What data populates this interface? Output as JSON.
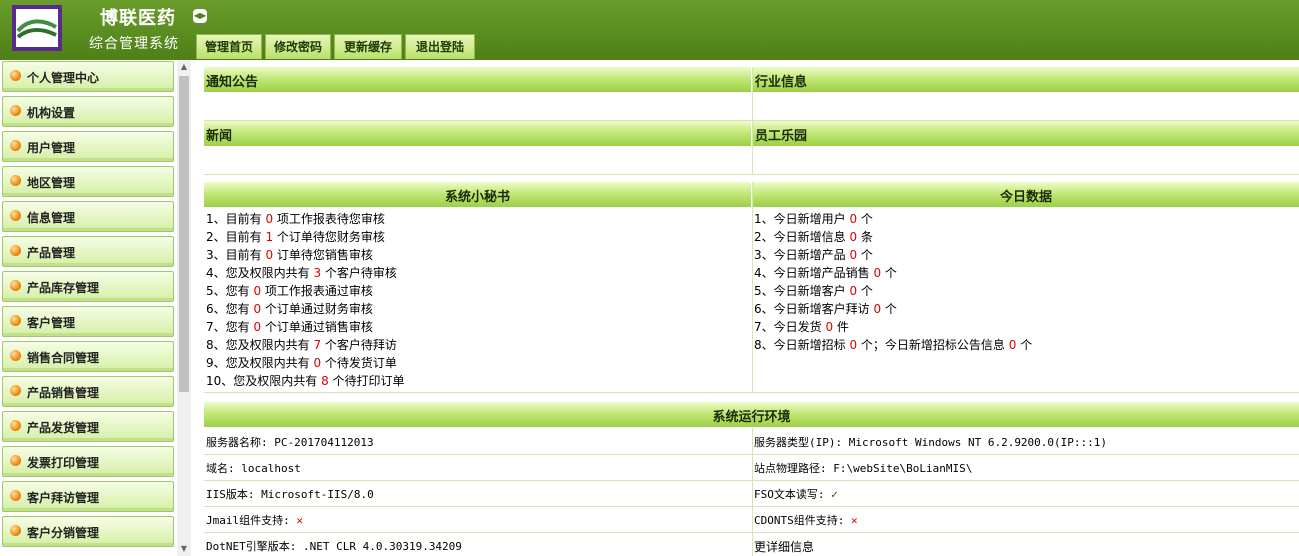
{
  "header": {
    "company": "博联医药",
    "system": "综合管理系统",
    "tabs": [
      "管理首页",
      "修改密码",
      "更新缓存",
      "退出登陆"
    ]
  },
  "sidebar": {
    "items": [
      "个人管理中心",
      "机构设置",
      "用户管理",
      "地区管理",
      "信息管理",
      "产品管理",
      "产品库存管理",
      "客户管理",
      "销售合同管理",
      "产品销售管理",
      "产品发货管理",
      "发票打印管理",
      "客户拜访管理",
      "客户分销管理"
    ]
  },
  "panels": {
    "notice": "通知公告",
    "industry": "行业信息",
    "news": "新闻",
    "staff": "员工乐园",
    "secretary": "系统小秘书",
    "today": "今日数据",
    "env": "系统运行环境"
  },
  "secretary": [
    {
      "pre": "1、目前有 ",
      "n": "0",
      "post": " 项工作报表待您审核"
    },
    {
      "pre": "2、目前有 ",
      "n": "1",
      "post": " 个订单待您财务审核"
    },
    {
      "pre": "3、目前有 ",
      "n": "0",
      "post": " 订单待您销售审核"
    },
    {
      "pre": "4、您及权限内共有 ",
      "n": "3",
      "post": " 个客户待审核"
    },
    {
      "pre": "5、您有 ",
      "n": "0",
      "post": " 项工作报表通过审核"
    },
    {
      "pre": "6、您有 ",
      "n": "0",
      "post": " 个订单通过财务审核"
    },
    {
      "pre": "7、您有 ",
      "n": "0",
      "post": " 个订单通过销售审核"
    },
    {
      "pre": "8、您及权限内共有 ",
      "n": "7",
      "post": " 个客户待拜访"
    },
    {
      "pre": "9、您及权限内共有 ",
      "n": "0",
      "post": " 个待发货订单"
    },
    {
      "pre": "10、您及权限内共有 ",
      "n": "8",
      "post": " 个待打印订单"
    }
  ],
  "today": [
    {
      "pre": "1、今日新增用户 ",
      "n": "0",
      "post": " 个",
      "n2": "",
      "post2": ""
    },
    {
      "pre": "2、今日新增信息 ",
      "n": "0",
      "post": " 条",
      "n2": "",
      "post2": ""
    },
    {
      "pre": "3、今日新增产品 ",
      "n": "0",
      "post": " 个",
      "n2": "",
      "post2": ""
    },
    {
      "pre": "4、今日新增产品销售 ",
      "n": "0",
      "post": " 个",
      "n2": "",
      "post2": ""
    },
    {
      "pre": "5、今日新增客户 ",
      "n": "0",
      "post": " 个",
      "n2": "",
      "post2": ""
    },
    {
      "pre": "6、今日新增客户拜访 ",
      "n": "0",
      "post": " 个",
      "n2": "",
      "post2": ""
    },
    {
      "pre": "7、今日发货 ",
      "n": "0",
      "post": " 件",
      "n2": "",
      "post2": ""
    },
    {
      "pre": "8、今日新增招标 ",
      "n": "0",
      "post": " 个；今日新增招标公告信息 ",
      "n2": "0",
      "post2": " 个"
    }
  ],
  "env": {
    "server_name_label": "服务器名称:",
    "server_name": "PC-201704112013",
    "server_type_label": "服务器类型(IP):",
    "server_type": "Microsoft Windows NT 6.2.9200.0(IP:::1)",
    "domain_label": "域名:",
    "domain": "localhost",
    "path_label": "站点物理路径:",
    "path": "F:\\webSite\\BoLianMIS\\",
    "iis_label": "IIS版本:",
    "iis": "Microsoft-IIS/8.0",
    "fso_label": "FSO文本读写:",
    "fso_mark": "✓",
    "jmail_label": "Jmail组件支持:",
    "jmail_mark": "✕",
    "cdonts_label": "CDONTS组件支持:",
    "cdonts_mark": "✕",
    "dotnet_label": "DotNET引擎版本:",
    "dotnet": ".NET CLR 4.0.30319.34209",
    "more": "更详细信息"
  }
}
